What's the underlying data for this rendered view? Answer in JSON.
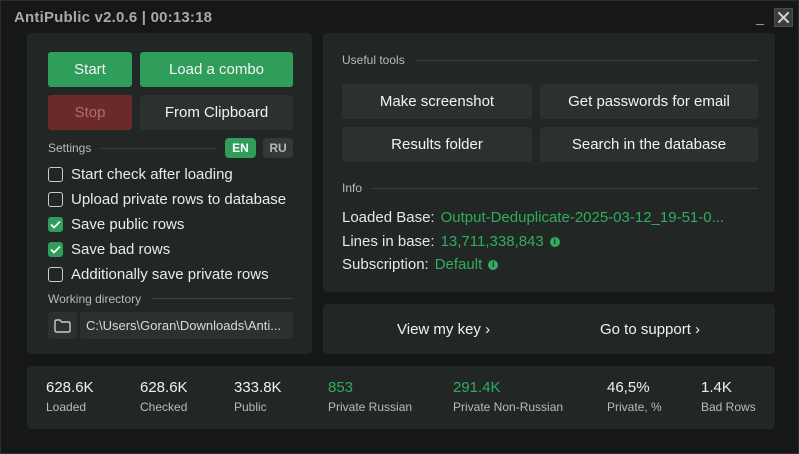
{
  "window": {
    "title": "AntiPublic v2.0.6 | 00:13:18",
    "minimize_glyph": "_",
    "close_icon": "close-icon"
  },
  "controls": {
    "start_label": "Start",
    "load_combo_label": "Load a combo",
    "stop_label": "Stop",
    "from_clipboard_label": "From Clipboard"
  },
  "settings": {
    "label": "Settings",
    "lang_en": "EN",
    "lang_ru": "RU",
    "selected_lang": "EN",
    "options": [
      {
        "label": "Start check after loading",
        "checked": false
      },
      {
        "label": "Upload private rows to database",
        "checked": false
      },
      {
        "label": "Save public rows",
        "checked": true
      },
      {
        "label": "Save bad rows",
        "checked": true
      },
      {
        "label": "Additionally save private rows",
        "checked": false
      }
    ]
  },
  "working_directory": {
    "label": "Working directory",
    "icon": "folder-icon",
    "path": "C:\\Users\\Goran\\Downloads\\Anti..."
  },
  "tools": {
    "label": "Useful tools",
    "make_screenshot": "Make screenshot",
    "get_passwords": "Get passwords for email",
    "results_folder": "Results folder",
    "search_database": "Search in the database"
  },
  "info": {
    "label": "Info",
    "loaded_base_key": "Loaded Base:",
    "loaded_base_val": "Output-Deduplicate-2025-03-12_19-51-0...",
    "lines_key": "Lines in base:",
    "lines_val": "13,711,338,843",
    "subscription_key": "Subscription:",
    "subscription_val": "Default"
  },
  "links": {
    "view_key": "View my key ›",
    "go_support": "Go to support ›"
  },
  "stats": [
    {
      "value": "628.6K",
      "label": "Loaded",
      "accent": false
    },
    {
      "value": "628.6K",
      "label": "Checked",
      "accent": false
    },
    {
      "value": "333.8K",
      "label": "Public",
      "accent": false
    },
    {
      "value": "853",
      "label": "Private Russian",
      "accent": true
    },
    {
      "value": "291.4K",
      "label": "Private Non-Russian",
      "accent": true
    },
    {
      "value": "46,5%",
      "label": "Private, %",
      "accent": false
    },
    {
      "value": "1.4K",
      "label": "Bad Rows",
      "accent": false
    }
  ],
  "colors": {
    "accent": "#2f9e5a",
    "accent_text": "#2fae62",
    "panel": "#222624",
    "background": "#161817",
    "stop_bg": "#6a2a2a"
  }
}
